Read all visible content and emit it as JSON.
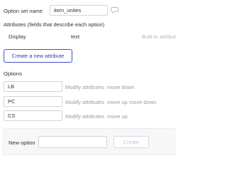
{
  "option_set": {
    "name_label": "Option set name",
    "name_value": "item_unites"
  },
  "attributes": {
    "heading": "Attributes (fields that describe each option)",
    "row": {
      "name": "Display",
      "type": "text",
      "extra": "Built-in attribut"
    },
    "create_button": "Create a new attribute"
  },
  "options": {
    "heading": "Options",
    "items": [
      {
        "value": "LB",
        "modify": "Modify attributes",
        "move1": "move down",
        "move2": ""
      },
      {
        "value": "PC",
        "modify": "Modify attributes",
        "move1": "move up",
        "move2": "move down"
      },
      {
        "value": "CS",
        "modify": "Modify attributes",
        "move1": "move up",
        "move2": ""
      }
    ]
  },
  "new_option": {
    "label": "New option",
    "value": "",
    "create_button": "Create"
  }
}
